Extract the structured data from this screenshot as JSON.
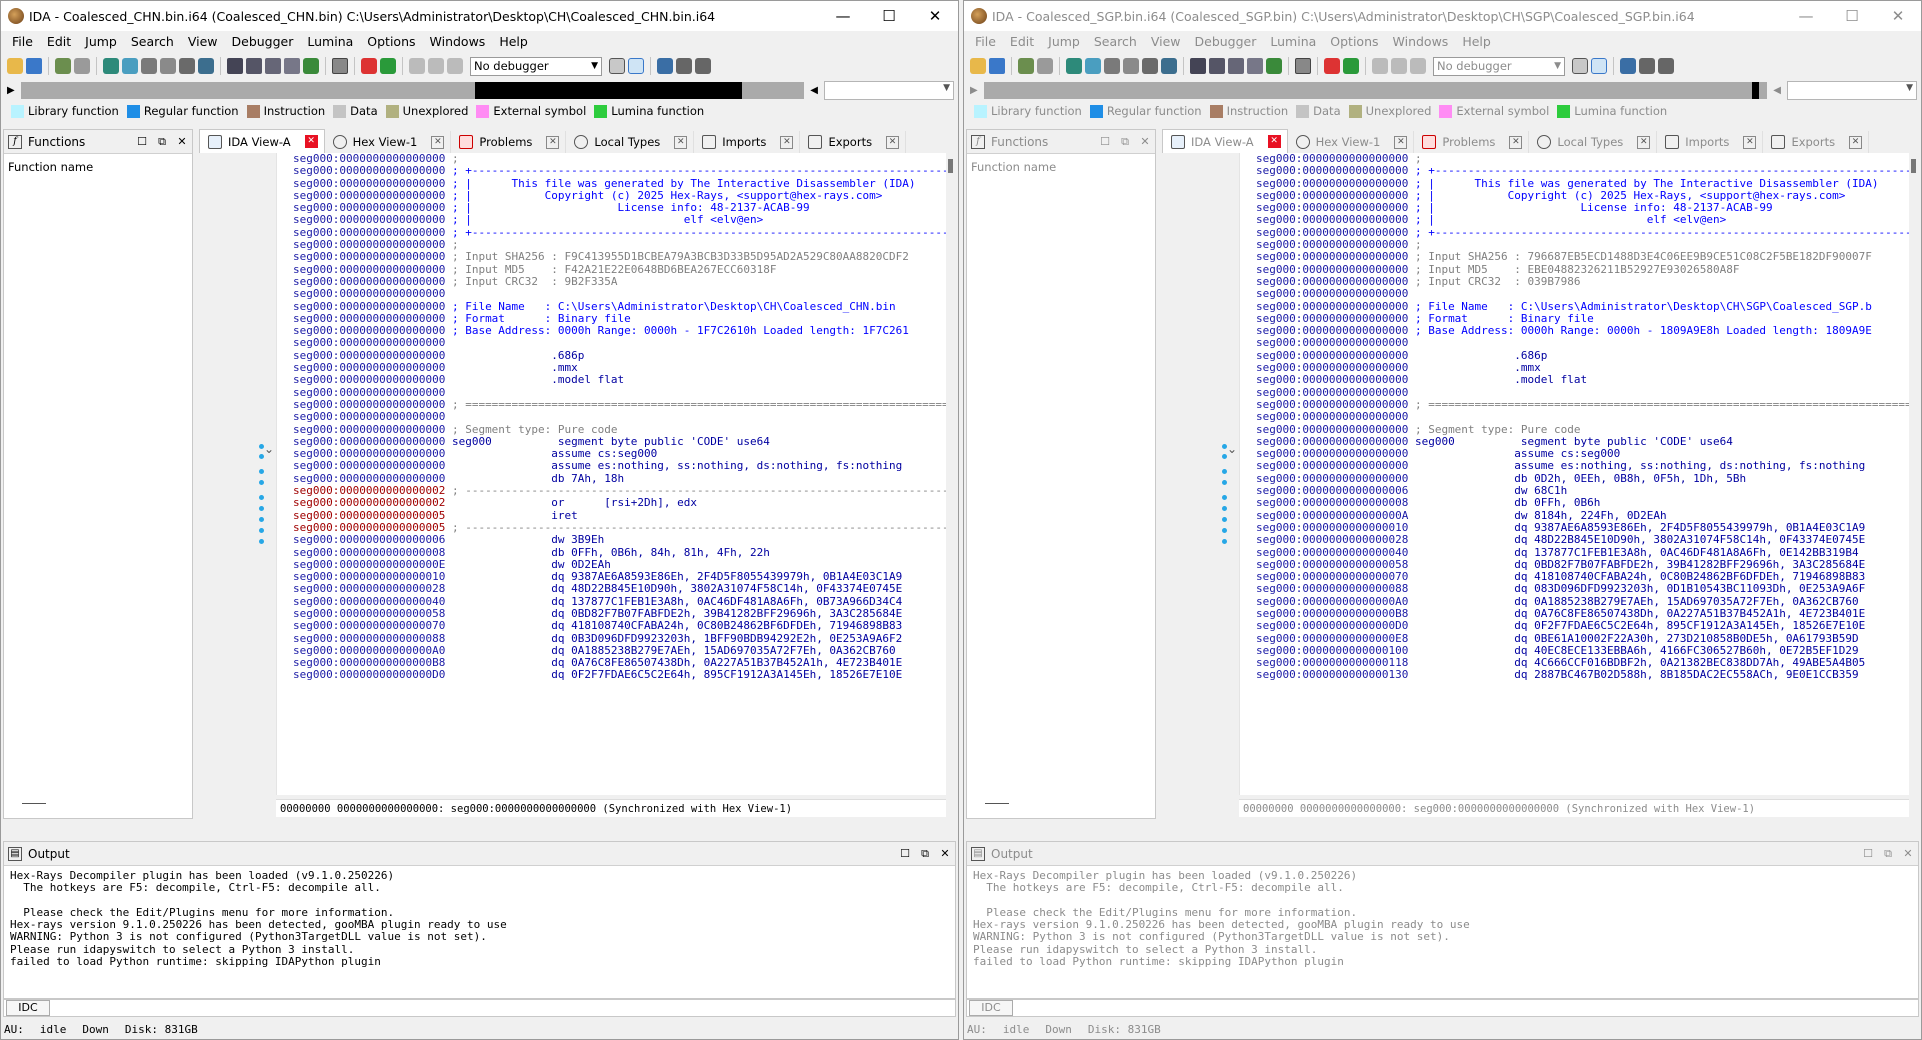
{
  "window_controls": {
    "minimize": "—",
    "maximize": "☐",
    "close": "✕"
  },
  "menu": [
    "File",
    "Edit",
    "Jump",
    "Search",
    "View",
    "Debugger",
    "Lumina",
    "Options",
    "Windows",
    "Help"
  ],
  "debugger_select": "No debugger",
  "legend": [
    {
      "label": "Library function",
      "color": "#b8f3ff"
    },
    {
      "label": "Regular function",
      "color": "#1f8ee6"
    },
    {
      "label": "Instruction",
      "color": "#a87d64"
    },
    {
      "label": "Data",
      "color": "#c4c4c4"
    },
    {
      "label": "Unexplored",
      "color": "#b1b180"
    },
    {
      "label": "External symbol",
      "color": "#ff8cf4"
    },
    {
      "label": "Lumina function",
      "color": "#2dcc3d"
    }
  ],
  "functions_panel": {
    "title": "Functions",
    "column": "Function name"
  },
  "tabs": [
    {
      "label": "IDA View-A",
      "active": true
    },
    {
      "label": "Hex View-1",
      "active": false
    },
    {
      "label": "Problems",
      "active": false
    },
    {
      "label": "Local Types",
      "active": false
    },
    {
      "label": "Imports",
      "active": false
    },
    {
      "label": "Exports",
      "active": false
    }
  ],
  "output": {
    "title": "Output",
    "lines": [
      "Hex-Rays Decompiler plugin has been loaded (v9.1.0.250226)",
      "  The hotkeys are F5: decompile, Ctrl-F5: decompile all.",
      "",
      "  Please check the Edit/Plugins menu for more information.",
      "Hex-rays version 9.1.0.250226 has been detected, gooMBA plugin ready to use",
      "WARNING: Python 3 is not configured (Python3TargetDLL value is not set).",
      "Please run idapyswitch to select a Python 3 install.",
      "failed to load Python runtime: skipping IDAPython plugin"
    ]
  },
  "idc_label": "IDC",
  "statusbar": {
    "au": "AU:",
    "state": "idle",
    "dir": "Down",
    "disk": "Disk: 831GB"
  },
  "windows": [
    {
      "title": "IDA - Coalesced_CHN.bin.i64 (Coalesced_CHN.bin) C:\\Users\\Administrator\\Desktop\\CH\\Coalesced_CHN.bin.i64",
      "inactive": false,
      "status_line": "00000000 0000000000000000: seg000:0000000000000000 (Synchronized with Hex View-1)",
      "lines": [
        {
          "a": "seg000:0000000000000000",
          "t": " ;",
          "k": "cm"
        },
        {
          "a": "seg000:0000000000000000",
          "t": " ; +-------------------------------------------------------------------------",
          "k": "cmb"
        },
        {
          "a": "seg000:0000000000000000",
          "t": " ; |      This file was generated by The Interactive Disassembler (IDA)",
          "k": "cmb"
        },
        {
          "a": "seg000:0000000000000000",
          "t": " ; |           Copyright (c) 2025 Hex-Rays, <support@hex-rays.com>",
          "k": "cmb"
        },
        {
          "a": "seg000:0000000000000000",
          "t": " ; |                      License info: 48-2137-ACAB-99",
          "k": "cmb"
        },
        {
          "a": "seg000:0000000000000000",
          "t": " ; |                                elf <elv@en>",
          "k": "cmb"
        },
        {
          "a": "seg000:0000000000000000",
          "t": " ; +-------------------------------------------------------------------------",
          "k": "cmb"
        },
        {
          "a": "seg000:0000000000000000",
          "t": " ;",
          "k": "cm"
        },
        {
          "a": "seg000:0000000000000000",
          "t": " ; Input SHA256 : F9C413955D1BCBEA79A3BCB3D33B5D95AD2A529C80AA8820CDF2",
          "k": "cm"
        },
        {
          "a": "seg000:0000000000000000",
          "t": " ; Input MD5    : F42A21E22E0648BD6BEA267ECC60318F",
          "k": "cm"
        },
        {
          "a": "seg000:0000000000000000",
          "t": " ; Input CRC32  : 9B2F335A",
          "k": "cm"
        },
        {
          "a": "seg000:0000000000000000",
          "t": "",
          "k": "cm"
        },
        {
          "a": "seg000:0000000000000000",
          "t": " ; File Name   : C:\\Users\\Administrator\\Desktop\\CH\\Coalesced_CHN.bin",
          "k": "cmb"
        },
        {
          "a": "seg000:0000000000000000",
          "t": " ; Format      : Binary file",
          "k": "cmb"
        },
        {
          "a": "seg000:0000000000000000",
          "t": " ; Base Address: 0000h Range: 0000h - 1F7C2610h Loaded length: 1F7C261",
          "k": "cmb"
        },
        {
          "a": "seg000:0000000000000000",
          "t": "",
          "k": "cm"
        },
        {
          "a": "seg000:0000000000000000",
          "t": "                .686p",
          "k": "op"
        },
        {
          "a": "seg000:0000000000000000",
          "t": "                .mmx",
          "k": "op"
        },
        {
          "a": "seg000:0000000000000000",
          "t": "                .model flat",
          "k": "op"
        },
        {
          "a": "seg000:0000000000000000",
          "t": "",
          "k": "cm"
        },
        {
          "a": "seg000:0000000000000000",
          "t": " ; ===========================================================================",
          "k": "cm"
        },
        {
          "a": "seg000:0000000000000000",
          "t": "",
          "k": "cm"
        },
        {
          "a": "seg000:0000000000000000",
          "t": " ; Segment type: Pure code",
          "k": "cm"
        },
        {
          "a": "seg000:0000000000000000",
          "t": " seg000          segment byte public 'CODE' use64",
          "k": "op"
        },
        {
          "a": "seg000:0000000000000000",
          "t": "                assume cs:seg000",
          "k": "op"
        },
        {
          "a": "seg000:0000000000000000",
          "t": "                assume es:nothing, ss:nothing, ds:nothing, fs:nothing",
          "k": "op"
        },
        {
          "a": "seg000:0000000000000000",
          "t": "                db 7Ah, 18h",
          "k": "op"
        },
        {
          "a": "seg000:0000000000000002",
          "t": " ; ---------------------------------------------------------------------------",
          "k": "cm",
          "r": true
        },
        {
          "a": "seg000:0000000000000002",
          "t": "                or      [rsi+2Dh], edx",
          "k": "op",
          "r": true
        },
        {
          "a": "seg000:0000000000000005",
          "t": "                iret",
          "k": "op",
          "r": true
        },
        {
          "a": "seg000:0000000000000005",
          "t": " ; ---------------------------------------------------------------------------",
          "k": "cm",
          "r": true
        },
        {
          "a": "seg000:0000000000000006",
          "t": "                dw 3B9Eh",
          "k": "op"
        },
        {
          "a": "seg000:0000000000000008",
          "t": "                db 0FFh, 0B6h, 84h, 81h, 4Fh, 22h",
          "k": "op"
        },
        {
          "a": "seg000:000000000000000E",
          "t": "                dw 0D2EAh",
          "k": "op"
        },
        {
          "a": "seg000:0000000000000010",
          "t": "                dq 9387AE6A8593E86Eh, 2F4D5F8055439979h, 0B1A4E03C1A9",
          "k": "op"
        },
        {
          "a": "seg000:0000000000000028",
          "t": "                dq 48D22B845E10D90h, 3802A31074F58C14h, 0F43374E0745E",
          "k": "op"
        },
        {
          "a": "seg000:0000000000000040",
          "t": "                dq 137877C1FEB1E3A8h, 0AC46DF481A8A6Fh, 0B73A966D34C4",
          "k": "op"
        },
        {
          "a": "seg000:0000000000000058",
          "t": "                dq 0BD82F7B07FABFDE2h, 39B41282BFF29696h, 3A3C285684E",
          "k": "op"
        },
        {
          "a": "seg000:0000000000000070",
          "t": "                dq 418108740CFABA24h, 0C80B24862BF6DFDEh, 71946898B83",
          "k": "op"
        },
        {
          "a": "seg000:0000000000000088",
          "t": "                dq 0B3D096DFD9923203h, 1BFF90BDB94292E2h, 0E253A9A6F2",
          "k": "op"
        },
        {
          "a": "seg000:00000000000000A0",
          "t": "                dq 0A1885238B279E7AEh, 15AD697035A72F7Eh, 0A362CB760",
          "k": "op"
        },
        {
          "a": "seg000:00000000000000B8",
          "t": "                dq 0A76C8FE86507438Dh, 0A227A51B37B452A1h, 4E723B401E",
          "k": "op"
        },
        {
          "a": "seg000:00000000000000D0",
          "t": "                dq 0F2F7FDAE6C5C2E64h, 895CF1912A3A145Eh, 18526E7E10E",
          "k": "op"
        }
      ]
    },
    {
      "title": "IDA - Coalesced_SGP.bin.i64 (Coalesced_SGP.bin) C:\\Users\\Administrator\\Desktop\\CH\\SGP\\Coalesced_SGP.bin.i64",
      "inactive": true,
      "status_line": "00000000 0000000000000000: seg000:0000000000000000 (Synchronized with Hex View-1)",
      "lines": [
        {
          "a": "seg000:0000000000000000",
          "t": " ;",
          "k": "cm"
        },
        {
          "a": "seg000:0000000000000000",
          "t": " ; +-------------------------------------------------------------------------",
          "k": "cmb"
        },
        {
          "a": "seg000:0000000000000000",
          "t": " ; |      This file was generated by The Interactive Disassembler (IDA)",
          "k": "cmb"
        },
        {
          "a": "seg000:0000000000000000",
          "t": " ; |           Copyright (c) 2025 Hex-Rays, <support@hex-rays.com>",
          "k": "cmb"
        },
        {
          "a": "seg000:0000000000000000",
          "t": " ; |                      License info: 48-2137-ACAB-99",
          "k": "cmb"
        },
        {
          "a": "seg000:0000000000000000",
          "t": " ; |                                elf <elv@en>",
          "k": "cmb"
        },
        {
          "a": "seg000:0000000000000000",
          "t": " ; +-------------------------------------------------------------------------",
          "k": "cmb"
        },
        {
          "a": "seg000:0000000000000000",
          "t": " ;",
          "k": "cm"
        },
        {
          "a": "seg000:0000000000000000",
          "t": " ; Input SHA256 : 796687EB5ECD1488D3E4C06EE9B9CE51C08C2F5BE182DF90007F",
          "k": "cm"
        },
        {
          "a": "seg000:0000000000000000",
          "t": " ; Input MD5    : EBE04882326211B52927E93026580A8F",
          "k": "cm"
        },
        {
          "a": "seg000:0000000000000000",
          "t": " ; Input CRC32  : 039B7986",
          "k": "cm"
        },
        {
          "a": "seg000:0000000000000000",
          "t": "",
          "k": "cm"
        },
        {
          "a": "seg000:0000000000000000",
          "t": " ; File Name   : C:\\Users\\Administrator\\Desktop\\CH\\SGP\\Coalesced_SGP.b",
          "k": "cmb"
        },
        {
          "a": "seg000:0000000000000000",
          "t": " ; Format      : Binary file",
          "k": "cmb"
        },
        {
          "a": "seg000:0000000000000000",
          "t": " ; Base Address: 0000h Range: 0000h - 1809A9E8h Loaded length: 1809A9E",
          "k": "cmb"
        },
        {
          "a": "seg000:0000000000000000",
          "t": "",
          "k": "cm"
        },
        {
          "a": "seg000:0000000000000000",
          "t": "                .686p",
          "k": "op"
        },
        {
          "a": "seg000:0000000000000000",
          "t": "                .mmx",
          "k": "op"
        },
        {
          "a": "seg000:0000000000000000",
          "t": "                .model flat",
          "k": "op"
        },
        {
          "a": "seg000:0000000000000000",
          "t": "",
          "k": "cm"
        },
        {
          "a": "seg000:0000000000000000",
          "t": " ; ===========================================================================",
          "k": "cm"
        },
        {
          "a": "seg000:0000000000000000",
          "t": "",
          "k": "cm"
        },
        {
          "a": "seg000:0000000000000000",
          "t": " ; Segment type: Pure code",
          "k": "cm"
        },
        {
          "a": "seg000:0000000000000000",
          "t": " seg000          segment byte public 'CODE' use64",
          "k": "op"
        },
        {
          "a": "seg000:0000000000000000",
          "t": "                assume cs:seg000",
          "k": "op"
        },
        {
          "a": "seg000:0000000000000000",
          "t": "                assume es:nothing, ss:nothing, ds:nothing, fs:nothing",
          "k": "op"
        },
        {
          "a": "seg000:0000000000000000",
          "t": "                db 0D2h, 0EEh, 0B8h, 0F5h, 1Dh, 5Bh",
          "k": "op"
        },
        {
          "a": "seg000:0000000000000006",
          "t": "                dw 68C1h",
          "k": "op"
        },
        {
          "a": "seg000:0000000000000008",
          "t": "                db 0FFh, 0B6h",
          "k": "op"
        },
        {
          "a": "seg000:000000000000000A",
          "t": "                dw 8184h, 224Fh, 0D2EAh",
          "k": "op"
        },
        {
          "a": "seg000:0000000000000010",
          "t": "                dq 9387AE6A8593E86Eh, 2F4D5F8055439979h, 0B1A4E03C1A9",
          "k": "op"
        },
        {
          "a": "seg000:0000000000000028",
          "t": "                dq 48D22B845E10D90h, 3802A31074F58C14h, 0F43374E0745E",
          "k": "op"
        },
        {
          "a": "seg000:0000000000000040",
          "t": "                dq 137877C1FEB1E3A8h, 0AC46DF481A8A6Fh, 0E142BB319B4",
          "k": "op"
        },
        {
          "a": "seg000:0000000000000058",
          "t": "                dq 0BD82F7B07FABFDE2h, 39B41282BFF29696h, 3A3C285684E",
          "k": "op"
        },
        {
          "a": "seg000:0000000000000070",
          "t": "                dq 418108740CFABA24h, 0C80B24862BF6DFDEh, 71946898B83",
          "k": "op"
        },
        {
          "a": "seg000:0000000000000088",
          "t": "                dq 083D096DFD9923203h, 0D1B10543BC11093Dh, 0E253A9A6F",
          "k": "op"
        },
        {
          "a": "seg000:00000000000000A0",
          "t": "                dq 0A1885238B279E7AEh, 15AD697035A72F7Eh, 0A362CB760",
          "k": "op"
        },
        {
          "a": "seg000:00000000000000B8",
          "t": "                dq 0A76C8FE86507438Dh, 0A227A51B37B452A1h, 4E723B401E",
          "k": "op"
        },
        {
          "a": "seg000:00000000000000D0",
          "t": "                dq 0F2F7FDAE6C5C2E64h, 895CF1912A3A145Eh, 18526E7E10E",
          "k": "op"
        },
        {
          "a": "seg000:00000000000000E8",
          "t": "                dq 0BE61A10002F22A30h, 273D210858B0DE5h, 0A61793B59D",
          "k": "op"
        },
        {
          "a": "seg000:0000000000000100",
          "t": "                dq 40EC8ECE133EBBA6h, 4166FC306527B60h, 0E72B5EF1D29",
          "k": "op"
        },
        {
          "a": "seg000:0000000000000118",
          "t": "                dq 4C666CCF016BDBF2h, 0A21382BEC838DD7Ah, 49ABE5A4B05",
          "k": "op"
        },
        {
          "a": "seg000:0000000000000130",
          "t": "                dq 2887BC467B02D588h, 8B185DAC2EC558ACh, 9E0E1CCB359",
          "k": "op"
        }
      ]
    }
  ]
}
